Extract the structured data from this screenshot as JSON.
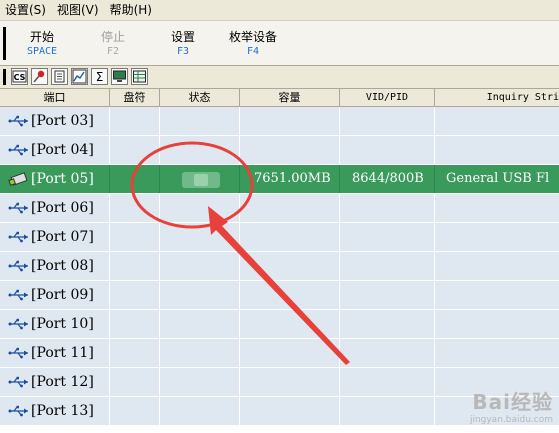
{
  "menu": {
    "items": [
      {
        "label": "设置(S)"
      },
      {
        "label": "视图(V)"
      },
      {
        "label": "帮助(H)"
      }
    ]
  },
  "function_bar": {
    "buttons": [
      {
        "label": "开始",
        "key": "SPACE",
        "enabled": true
      },
      {
        "label": "停止",
        "key": "F2",
        "enabled": false
      },
      {
        "label": "设置",
        "key": "F3",
        "enabled": true
      },
      {
        "label": "枚举设备",
        "key": "F4",
        "enabled": true
      }
    ]
  },
  "toolbar_icons": [
    "cs-icon",
    "pin-icon",
    "document-icon",
    "chart-icon",
    "sigma-icon",
    "monitor-icon",
    "grid-icon"
  ],
  "table": {
    "columns": [
      "端口",
      "盘符",
      "状态",
      "容量",
      "VID/PID",
      "Inquiry Stri"
    ],
    "rows": [
      {
        "port": "[Port 03]",
        "drive": "",
        "capacity": "",
        "vidpid": "",
        "inquiry": "",
        "selected": false
      },
      {
        "port": "[Port 04]",
        "drive": "",
        "capacity": "",
        "vidpid": "",
        "inquiry": "",
        "selected": false
      },
      {
        "port": "[Port 05]",
        "drive": "",
        "capacity": "7651.00MB",
        "vidpid": "8644/800B",
        "inquiry": "General USB Fl",
        "selected": true
      },
      {
        "port": "[Port 06]",
        "drive": "",
        "capacity": "",
        "vidpid": "",
        "inquiry": "",
        "selected": false
      },
      {
        "port": "[Port 07]",
        "drive": "",
        "capacity": "",
        "vidpid": "",
        "inquiry": "",
        "selected": false
      },
      {
        "port": "[Port 08]",
        "drive": "",
        "capacity": "",
        "vidpid": "",
        "inquiry": "",
        "selected": false
      },
      {
        "port": "[Port 09]",
        "drive": "",
        "capacity": "",
        "vidpid": "",
        "inquiry": "",
        "selected": false
      },
      {
        "port": "[Port 10]",
        "drive": "",
        "capacity": "",
        "vidpid": "",
        "inquiry": "",
        "selected": false
      },
      {
        "port": "[Port 11]",
        "drive": "",
        "capacity": "",
        "vidpid": "",
        "inquiry": "",
        "selected": false
      },
      {
        "port": "[Port 12]",
        "drive": "",
        "capacity": "",
        "vidpid": "",
        "inquiry": "",
        "selected": false
      },
      {
        "port": "[Port 13]",
        "drive": "",
        "capacity": "",
        "vidpid": "",
        "inquiry": "",
        "selected": false
      }
    ]
  },
  "colors": {
    "row_bg": "#dfe8f0",
    "selected_row_bg": "#3a9a5c",
    "annotation": "#e8403a"
  },
  "watermark": {
    "main": "Bai经验",
    "sub": "jingyan.baidu.com"
  }
}
